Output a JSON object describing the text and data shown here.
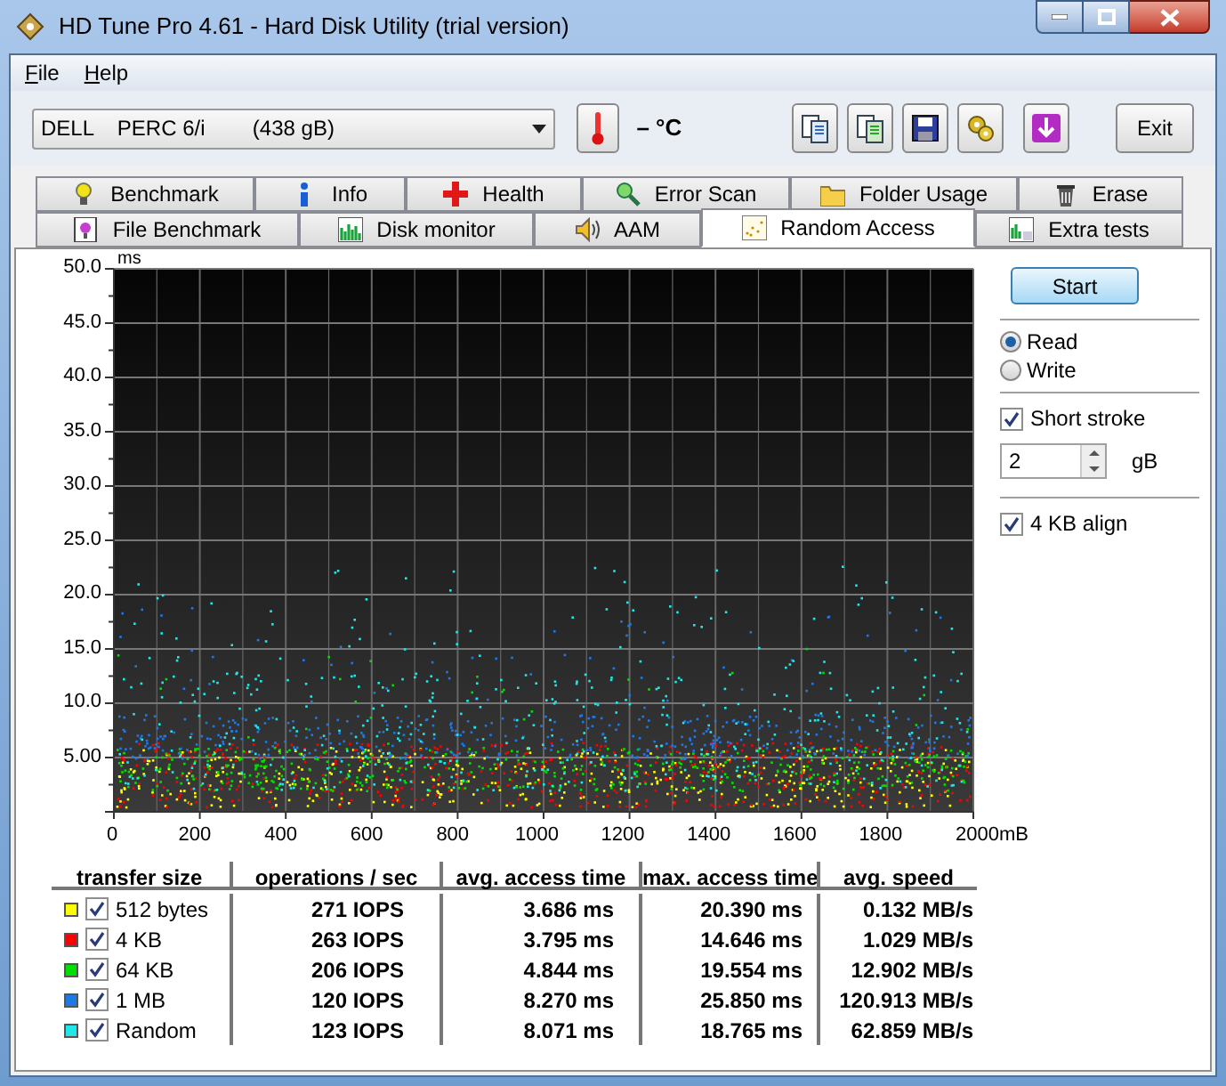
{
  "window": {
    "title": "HD Tune Pro 4.61 - Hard Disk Utility (trial version)"
  },
  "menu": [
    "File",
    "Help"
  ],
  "drive_select": {
    "value": "DELL    PERC 6/i        (438 gB)"
  },
  "temperature": "– °C",
  "exit_button": "Exit",
  "tabs": [
    [
      {
        "label": "Benchmark",
        "selected": false
      },
      {
        "label": "Info",
        "selected": false
      },
      {
        "label": "Health",
        "selected": false
      },
      {
        "label": "Error Scan",
        "selected": false
      },
      {
        "label": "Folder Usage",
        "selected": false
      },
      {
        "label": "Erase",
        "selected": false
      }
    ],
    [
      {
        "label": "File Benchmark",
        "selected": false
      },
      {
        "label": "Disk monitor",
        "selected": false
      },
      {
        "label": "AAM",
        "selected": false
      },
      {
        "label": "Random Access",
        "selected": true
      },
      {
        "label": "Extra tests",
        "selected": false
      }
    ]
  ],
  "controls": {
    "start_button": "Start",
    "mode": [
      {
        "label": "Read",
        "selected": true
      },
      {
        "label": "Write",
        "selected": false
      }
    ],
    "short_stroke": {
      "label": "Short stroke",
      "checked": true
    },
    "stroke_size": {
      "value": "2",
      "unit": "gB"
    },
    "align": {
      "label": "4 KB align",
      "checked": true
    }
  },
  "graph": {
    "y_unit": "ms",
    "y_ticks": [
      "50.0",
      "45.0",
      "40.0",
      "35.0",
      "30.0",
      "25.0",
      "20.0",
      "15.0",
      "10.0",
      "5.00"
    ],
    "x_ticks": [
      "0",
      "200",
      "400",
      "600",
      "800",
      "1000",
      "1200",
      "1400",
      "1600",
      "1800",
      "2000mB"
    ]
  },
  "results": {
    "columns": [
      "transfer size",
      "operations / sec",
      "avg. access time",
      "max. access time",
      "avg. speed"
    ],
    "rows": [
      {
        "color": "#ffff00",
        "checked": true,
        "size": "512 bytes",
        "ops": "271 IOPS",
        "avg": "3.686 ms",
        "max": "20.390 ms",
        "speed": "0.132 MB/s"
      },
      {
        "color": "#ff0000",
        "checked": true,
        "size": "4 KB",
        "ops": "263 IOPS",
        "avg": "3.795 ms",
        "max": "14.646 ms",
        "speed": "1.029 MB/s"
      },
      {
        "color": "#00e000",
        "checked": true,
        "size": "64 KB",
        "ops": "206 IOPS",
        "avg": "4.844 ms",
        "max": "19.554 ms",
        "speed": "12.902 MB/s"
      },
      {
        "color": "#1e78e6",
        "checked": true,
        "size": "1 MB",
        "ops": "120 IOPS",
        "avg": "8.270 ms",
        "max": "25.850 ms",
        "speed": "120.913 MB/s"
      },
      {
        "color": "#20e8e8",
        "checked": true,
        "size": "Random",
        "ops": "123 IOPS",
        "avg": "8.071 ms",
        "max": "18.765 ms",
        "speed": "62.859 MB/s"
      }
    ]
  }
}
